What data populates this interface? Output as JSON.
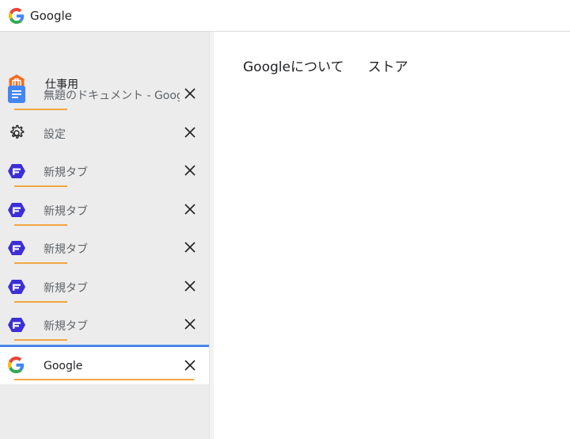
{
  "window": {
    "title": "Google"
  },
  "workspace": {
    "label": "仕事用"
  },
  "tabs": [
    {
      "label": "無題のドキュメント - Google ドキュメント",
      "icon": "google-docs-icon"
    },
    {
      "label": "設定",
      "icon": "gear-icon"
    },
    {
      "label": "新規タブ",
      "icon": "new-tab-icon"
    },
    {
      "label": "新規タブ",
      "icon": "new-tab-icon"
    },
    {
      "label": "新規タブ",
      "icon": "new-tab-icon"
    },
    {
      "label": "新規タブ",
      "icon": "new-tab-icon"
    },
    {
      "label": "新規タブ",
      "icon": "new-tab-icon"
    },
    {
      "label": "Google",
      "icon": "google-icon",
      "active": true
    }
  ],
  "page": {
    "links": [
      "Googleについて",
      "ストア"
    ]
  },
  "colors": {
    "accent": "#4a86e8",
    "underline": "#f0a640",
    "sidebar": "#ececec",
    "newtab_icon": "#3d2fd6",
    "workspace_icon": "#f36c21"
  }
}
